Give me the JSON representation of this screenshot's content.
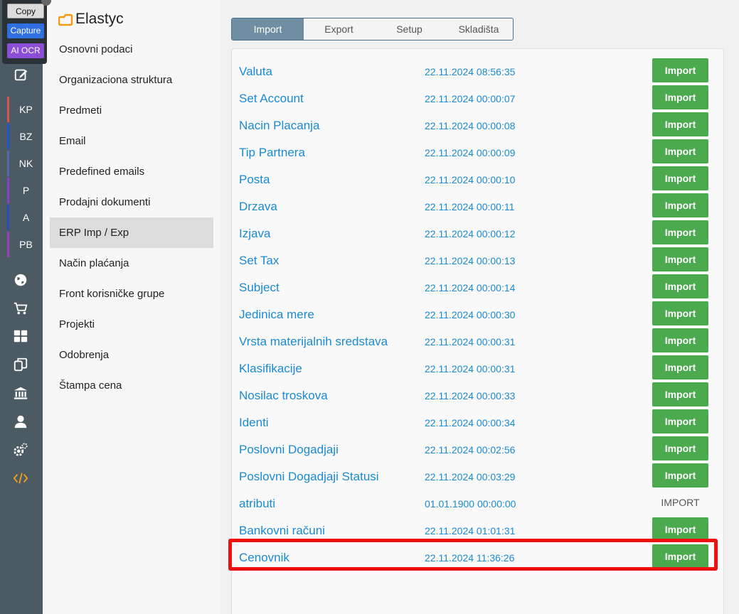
{
  "overlay_tools": {
    "copy": "Copy",
    "capture": "Capture",
    "ocr": "AI OCR"
  },
  "app": {
    "name": "Elastyc"
  },
  "rail": {
    "items": [
      {
        "label": "KP",
        "color": "#d9534f"
      },
      {
        "label": "BZ",
        "color": "#2255cc"
      },
      {
        "label": "NK",
        "color": "#5566aa"
      },
      {
        "label": "P",
        "color": "#8a3fc7"
      },
      {
        "label": "A",
        "color": "#2a4fb8"
      },
      {
        "label": "PB",
        "color": "#9b3fb8"
      }
    ],
    "icons": [
      "edit-icon",
      "globe-icon",
      "cart-icon",
      "dashboard-icon",
      "documents-icon",
      "bank-icon",
      "user-icon",
      "settings-icon",
      "code-icon"
    ]
  },
  "menu": {
    "items": [
      "Osnovni podaci",
      "Organizaciona struktura",
      "Predmeti",
      "Email",
      "Predefined emails",
      "Prodajni dokumenti",
      "ERP Imp / Exp",
      "Način plaćanja",
      "Front korisničke grupe",
      "Projekti",
      "Odobrenja",
      "Štampa cena"
    ],
    "active": "ERP Imp / Exp"
  },
  "tabs": [
    "Import",
    "Export",
    "Setup",
    "Skladišta"
  ],
  "active_tab": "Import",
  "rows": [
    {
      "name": "Valuta",
      "date": "22.11.2024 08:56:35",
      "button": "Import"
    },
    {
      "name": "Set Account",
      "date": "22.11.2024 00:00:07",
      "button": "Import"
    },
    {
      "name": "Nacin Placanja",
      "date": "22.11.2024 00:00:08",
      "button": "Import"
    },
    {
      "name": "Tip Partnera",
      "date": "22.11.2024 00:00:09",
      "button": "Import"
    },
    {
      "name": "Posta",
      "date": "22.11.2024 00:00:10",
      "button": "Import"
    },
    {
      "name": "Drzava",
      "date": "22.11.2024 00:00:11",
      "button": "Import"
    },
    {
      "name": "Izjava",
      "date": "22.11.2024 00:00:12",
      "button": "Import"
    },
    {
      "name": "Set Tax",
      "date": "22.11.2024 00:00:13",
      "button": "Import"
    },
    {
      "name": "Subject",
      "date": "22.11.2024 00:00:14",
      "button": "Import"
    },
    {
      "name": "Jedinica mere",
      "date": "22.11.2024 00:00:30",
      "button": "Import"
    },
    {
      "name": "Vrsta materijalnih sredstava",
      "date": "22.11.2024 00:00:31",
      "button": "Import"
    },
    {
      "name": "Klasifikacije",
      "date": "22.11.2024 00:00:31",
      "button": "Import"
    },
    {
      "name": "Nosilac troskova",
      "date": "22.11.2024 00:00:33",
      "button": "Import"
    },
    {
      "name": "Identi",
      "date": "22.11.2024 00:00:34",
      "button": "Import"
    },
    {
      "name": "Poslovni Dogadjaji",
      "date": "22.11.2024 00:02:56",
      "button": "Import"
    },
    {
      "name": "Poslovni Dogadjaji Statusi",
      "date": "22.11.2024 00:03:29",
      "button": "Import"
    },
    {
      "name": "atributi",
      "date": "01.01.1900 00:00:00",
      "button": "IMPORT",
      "plain": true
    },
    {
      "name": "Bankovni računi",
      "date": "22.11.2024 01:01:31",
      "button": "Import"
    },
    {
      "name": "Cenovnik",
      "date": "22.11.2024 11:36:26",
      "button": "Import",
      "highlighted": true
    }
  ],
  "colors": {
    "accent_blue": "#1a8ad3",
    "button_green": "#4aaa4d",
    "highlight_red": "#ee1111",
    "tab_active": "#6f8ea3"
  }
}
